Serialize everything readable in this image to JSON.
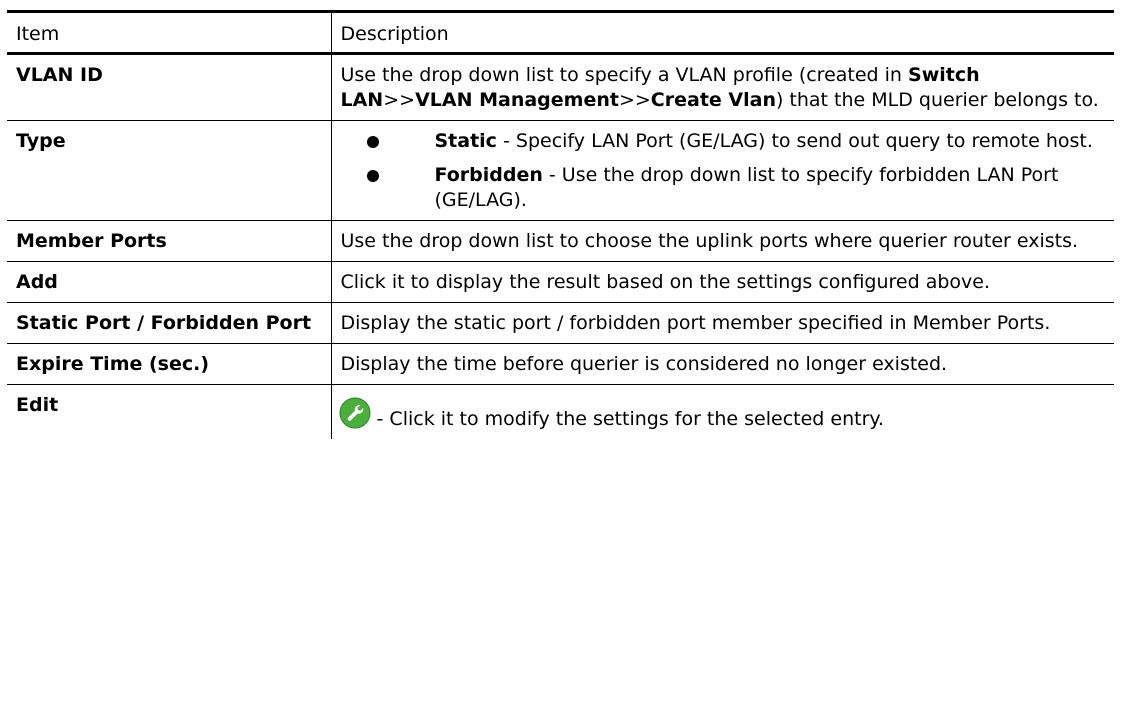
{
  "headers": {
    "item": "Item",
    "description": "Description"
  },
  "rows": {
    "vlan_id": {
      "item": "VLAN ID",
      "desc_1": "Use the drop down list to specify a VLAN profile (created in",
      "path_1": "Switch LAN",
      "sep_1": ">>",
      "path_2": "VLAN Management",
      "sep_2": ">>",
      "path_3": "Create Vlan",
      "desc_2": ") that the MLD querier belongs to."
    },
    "type": {
      "item": "Type",
      "bullet_1_term": "Static",
      "bullet_1_text": " - Specify LAN Port (GE/LAG) to send out query to remote host.",
      "bullet_2_term": "Forbidden",
      "bullet_2_text": " - Use the drop down list to specify forbidden LAN Port (GE/LAG)."
    },
    "member_ports": {
      "item": "Member Ports",
      "desc": "Use the drop down list to choose the uplink ports where querier router exists."
    },
    "add": {
      "item": "Add",
      "desc": "Click it to display the result based on the settings configured above."
    },
    "static_forbidden": {
      "item": "Static Port / Forbidden Port",
      "desc": "Display the static port / forbidden port member specified in Member Ports."
    },
    "expire_time": {
      "item": "Expire Time (sec.)",
      "desc": "Display the time before querier is considered no longer existed."
    },
    "edit": {
      "item": "Edit",
      "desc": " - Click it to modify the settings for the selected entry.",
      "icon": "wrench-edit-icon",
      "icon_color": "#4caf3c"
    }
  }
}
